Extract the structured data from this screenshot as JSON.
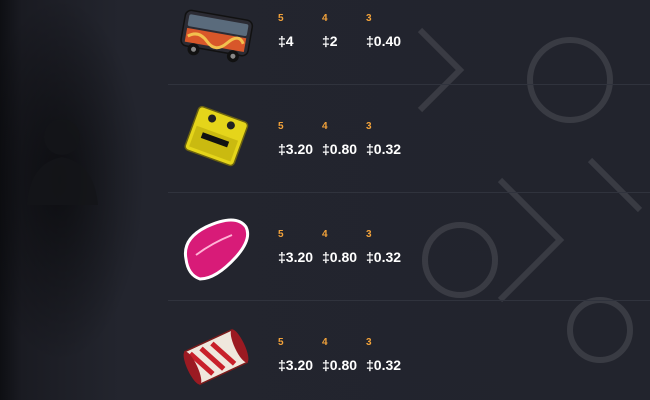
{
  "paytable": {
    "currency": "‡",
    "rows": [
      {
        "symbol": "bus-icon",
        "pays": [
          {
            "count": "5",
            "amount": "‡4"
          },
          {
            "count": "4",
            "amount": "‡2"
          },
          {
            "count": "3",
            "amount": "‡0.40"
          }
        ]
      },
      {
        "symbol": "guitar-pedal-icon",
        "pays": [
          {
            "count": "5",
            "amount": "‡3.20"
          },
          {
            "count": "4",
            "amount": "‡0.80"
          },
          {
            "count": "3",
            "amount": "‡0.32"
          }
        ]
      },
      {
        "symbol": "guitar-pick-icon",
        "pays": [
          {
            "count": "5",
            "amount": "‡3.20"
          },
          {
            "count": "4",
            "amount": "‡0.80"
          },
          {
            "count": "3",
            "amount": "‡0.32"
          }
        ]
      },
      {
        "symbol": "ticket-scroll-icon",
        "pays": [
          {
            "count": "5",
            "amount": "‡3.20"
          },
          {
            "count": "4",
            "amount": "‡0.80"
          },
          {
            "count": "3",
            "amount": "‡0.32"
          }
        ]
      }
    ]
  },
  "colors": {
    "background": "#22242d",
    "count_label": "#f2a23a",
    "amount": "#ffffff",
    "divider": "#30333d"
  }
}
